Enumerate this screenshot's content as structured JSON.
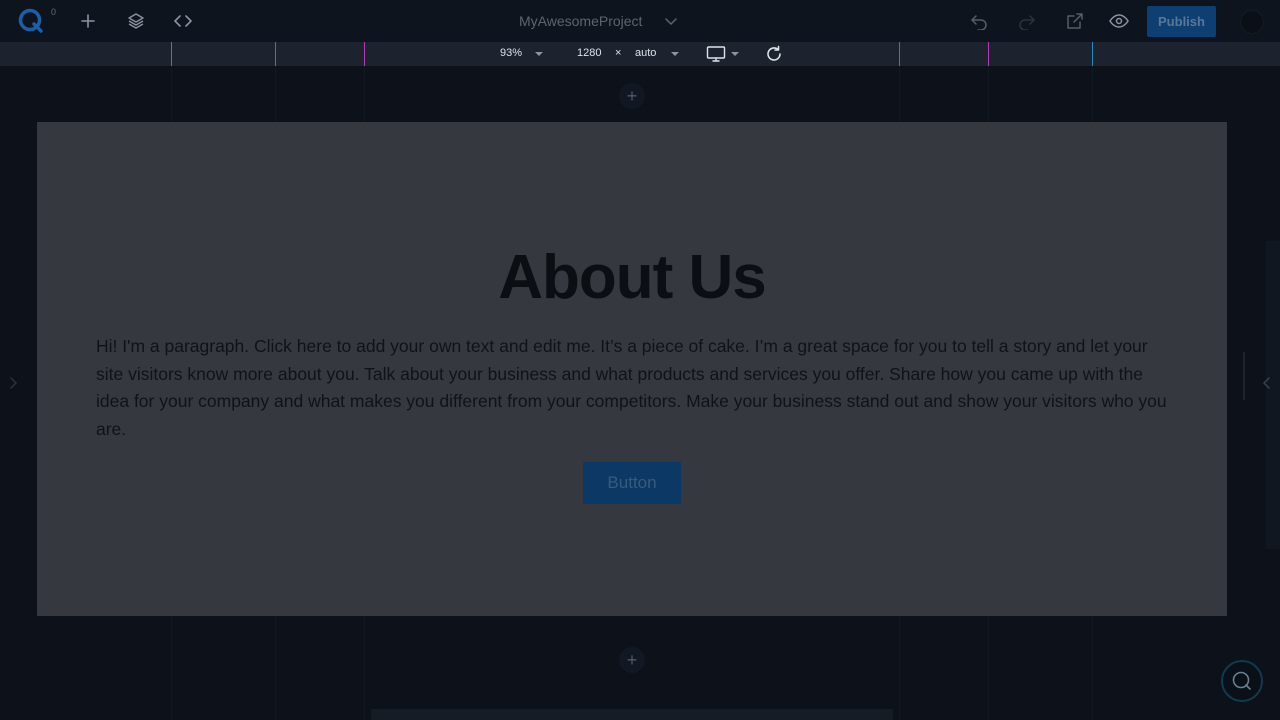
{
  "topbar": {
    "logo_letter": "Q",
    "logo_badge": "0",
    "project_title": "MyAwesomeProject",
    "publish_label": "Publish"
  },
  "viewbar": {
    "zoom": "93%",
    "width": "1280",
    "times": "×",
    "height": "auto"
  },
  "page": {
    "heading": "About Us",
    "paragraph": "Hi! I'm a paragraph. Click here to add your own text and edit me. It’s a piece of cake. I’m a great space for you to tell a story and let your site visitors know more about you. Talk about your business and what products and services you offer. Share how you came up with the idea for your company and what makes you different from your competitors. Make your business stand out and show your visitors who you are.",
    "button_label": "Button",
    "add_section_symbol": "+"
  },
  "colors": {
    "accent": "#0d3f73",
    "breakpoint_blue": "#2e86c1",
    "breakpoint_pink": "#b73ab7",
    "section_bg": "#35393f"
  }
}
